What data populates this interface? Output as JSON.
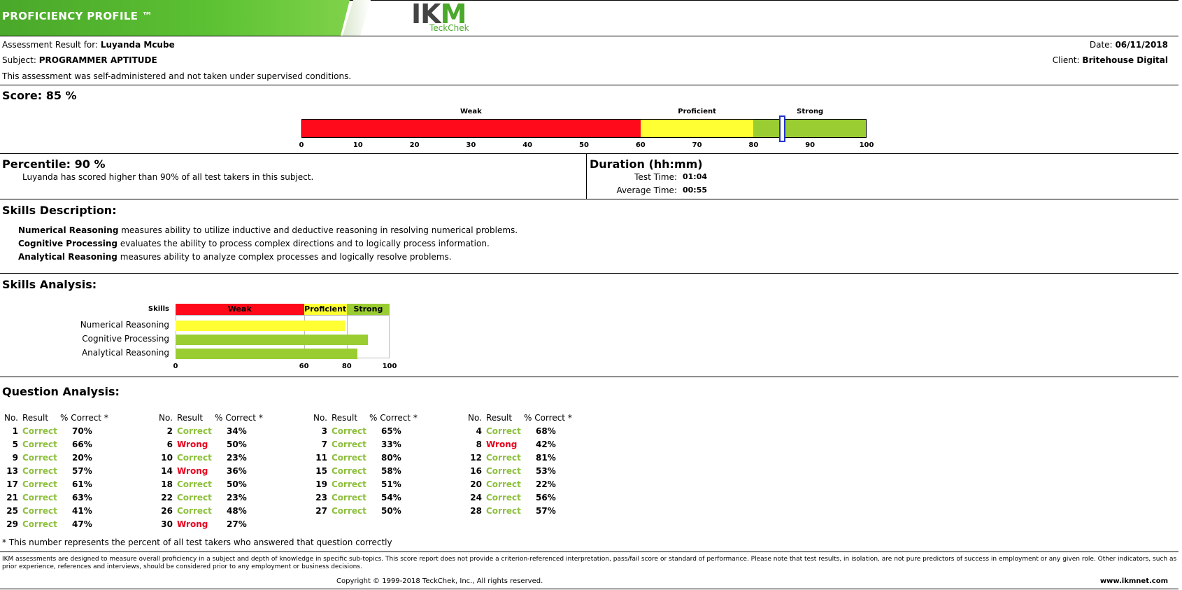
{
  "header": {
    "title": "PROFICIENCY PROFILE ™",
    "logo_main": "IKM",
    "logo_sub": "TeckChek"
  },
  "info": {
    "result_for_label": "Assessment Result for:",
    "result_for_name": "Luyanda Mcube",
    "subject_label": "Subject:",
    "subject_value": "PROGRAMMER APTITUDE",
    "admin_note": "This assessment was self-administered and not taken under supervised conditions.",
    "date_label": "Date:",
    "date_value": "06/11/2018",
    "client_label": "Client:",
    "client_value": "Britehouse Digital"
  },
  "score": {
    "title": "Score: 85 %",
    "value": 85,
    "zones": [
      "Weak",
      "Proficient",
      "Strong"
    ],
    "ticks": [
      "0",
      "10",
      "20",
      "30",
      "40",
      "50",
      "60",
      "70",
      "80",
      "90",
      "100"
    ]
  },
  "percentile": {
    "title": "Percentile: 90 %",
    "text": "Luyanda has scored higher than 90% of all test takers in this subject."
  },
  "duration": {
    "title": "Duration (hh:mm)",
    "test_time_label": "Test Time:",
    "test_time_value": "01:04",
    "avg_time_label": "Average Time:",
    "avg_time_value": "00:55"
  },
  "skills_description": {
    "title": "Skills Description:",
    "items": [
      {
        "name": "Numerical Reasoning",
        "text": " measures ability to utilize inductive and deductive reasoning in resolving numerical problems."
      },
      {
        "name": "Cognitive Processing",
        "text": " evaluates the ability to process complex directions and to logically process information."
      },
      {
        "name": "Analytical Reasoning",
        "text": " measures ability to analyze complex processes and  logically resolve problems."
      }
    ]
  },
  "skills_analysis": {
    "title": "Skills Analysis:",
    "skills_label": "Skills",
    "zones": [
      "Weak",
      "Proficient",
      "Strong"
    ],
    "ticks": [
      "0",
      "60",
      "80",
      "100"
    ],
    "chart_data": {
      "type": "bar",
      "categories": [
        "Numerical Reasoning",
        "Cognitive Processing",
        "Analytical Reasoning"
      ],
      "values": [
        79,
        90,
        85
      ],
      "xlim": [
        0,
        100
      ]
    },
    "colors": {
      "weak": "#ff0a1a",
      "proficient": "#ffff33",
      "strong": "#9acd32"
    }
  },
  "question_analysis": {
    "title": "Question Analysis:",
    "col_no": "No.",
    "col_result": "Result",
    "col_pct": "% Correct *",
    "columns": [
      [
        {
          "no": "1",
          "result": "Correct",
          "pct": "70%"
        },
        {
          "no": "5",
          "result": "Correct",
          "pct": "66%"
        },
        {
          "no": "9",
          "result": "Correct",
          "pct": "20%"
        },
        {
          "no": "13",
          "result": "Correct",
          "pct": "57%"
        },
        {
          "no": "17",
          "result": "Correct",
          "pct": "61%"
        },
        {
          "no": "21",
          "result": "Correct",
          "pct": "63%"
        },
        {
          "no": "25",
          "result": "Correct",
          "pct": "41%"
        },
        {
          "no": "29",
          "result": "Correct",
          "pct": "47%"
        }
      ],
      [
        {
          "no": "2",
          "result": "Correct",
          "pct": "34%"
        },
        {
          "no": "6",
          "result": "Wrong",
          "pct": "50%"
        },
        {
          "no": "10",
          "result": "Correct",
          "pct": "23%"
        },
        {
          "no": "14",
          "result": "Wrong",
          "pct": "36%"
        },
        {
          "no": "18",
          "result": "Correct",
          "pct": "50%"
        },
        {
          "no": "22",
          "result": "Correct",
          "pct": "23%"
        },
        {
          "no": "26",
          "result": "Correct",
          "pct": "48%"
        },
        {
          "no": "30",
          "result": "Wrong",
          "pct": "27%"
        }
      ],
      [
        {
          "no": "3",
          "result": "Correct",
          "pct": "65%"
        },
        {
          "no": "7",
          "result": "Correct",
          "pct": "33%"
        },
        {
          "no": "11",
          "result": "Correct",
          "pct": "80%"
        },
        {
          "no": "15",
          "result": "Correct",
          "pct": "58%"
        },
        {
          "no": "19",
          "result": "Correct",
          "pct": "51%"
        },
        {
          "no": "23",
          "result": "Correct",
          "pct": "54%"
        },
        {
          "no": "27",
          "result": "Correct",
          "pct": "50%"
        }
      ],
      [
        {
          "no": "4",
          "result": "Correct",
          "pct": "68%"
        },
        {
          "no": "8",
          "result": "Wrong",
          "pct": "42%"
        },
        {
          "no": "12",
          "result": "Correct",
          "pct": "81%"
        },
        {
          "no": "16",
          "result": "Correct",
          "pct": "53%"
        },
        {
          "no": "20",
          "result": "Correct",
          "pct": "22%"
        },
        {
          "no": "24",
          "result": "Correct",
          "pct": "56%"
        },
        {
          "no": "28",
          "result": "Correct",
          "pct": "57%"
        }
      ]
    ],
    "footnote": "* This number represents the percent of all test takers who answered that question correctly"
  },
  "footer": {
    "disclaimer": "IKM assessments are designed to measure overall proficiency in a subject and depth of knowledge in specific sub-topics. This score report does not provide a criterion-referenced interpretation, pass/fail score or standard of performance. Please note that test results, in isolation, are not pure predictors of success in employment or any given role. Other indicators, such as prior experience, references and interviews, should be considered prior to any employment or business decisions.",
    "copyright": "Copyright © 1999-2018 TeckChek, Inc., All rights reserved.",
    "website": "www.ikmnet.com"
  },
  "colors": {
    "weak": "#ff0a1a",
    "proficient": "#ffff33",
    "strong": "#9acd32",
    "marker": "#2233cc",
    "correct": "#8dc03c",
    "wrong": "#e8001c"
  }
}
